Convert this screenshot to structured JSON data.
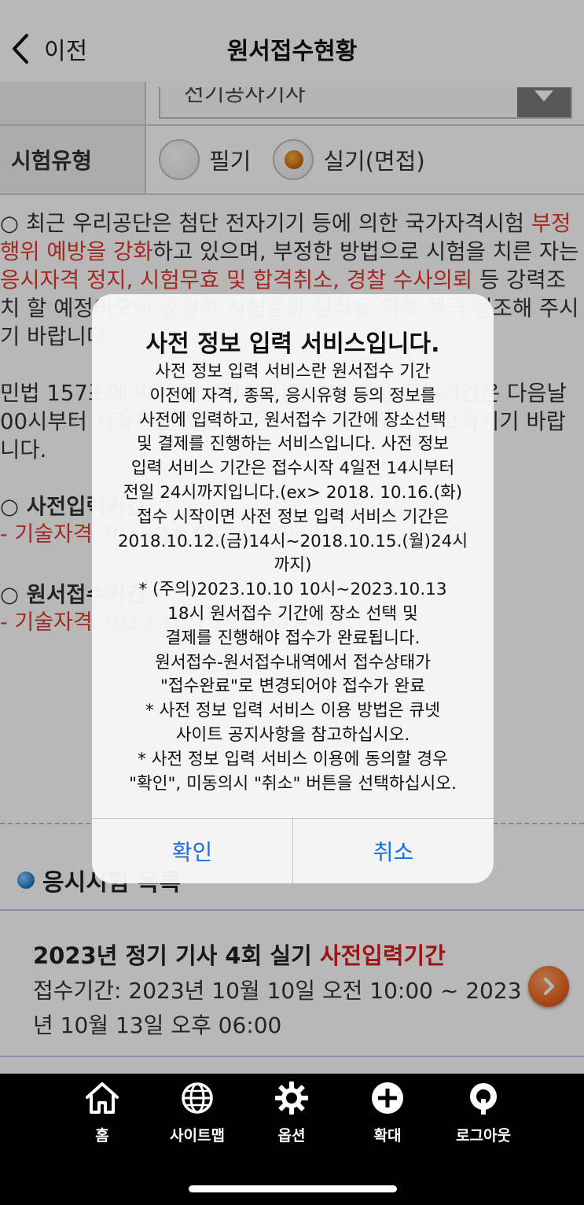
{
  "header": {
    "back_label": "이전",
    "title": "원서접수현황"
  },
  "form": {
    "category_value": "전기공사기사",
    "exam_type_label": "시험유형",
    "options": [
      "필기",
      "실기(면접)"
    ],
    "selected_option": "실기(면접)"
  },
  "notice": {
    "p1_a": "○ 최근 우리공단은 첨단 전자기기 등에 의한 국가자격시험 ",
    "p1_red1": "부정행위 예방을 강화",
    "p1_b": "하고 있으며, 부정한 방법으로 시험을 치른 자는 ",
    "p1_red2": "응시자격 정지, 시험무효 및 합격취소, 경찰 수사의뢰",
    "p1_c": " 등 강력조치 할 예정이오니 공정한 시험문화 정착을 위해 적극 협조해 주시기 바랍니다.",
    "p2": "민법 157조에 따라 원서접수 시작일에 대한 면제기간은 다음날 00시부터 시작하는 것을 기준으로 적용되오니 참고하시기 바랍니다.",
    "s1_head": "○ 사전입력기간",
    "s1_line": "- 기술자격  2023.10.06 14:00부터",
    "s2_head": "○ 원서접수기간",
    "s2_line": "- 기술자격  2023.10.10 10:00 부터"
  },
  "schedule": {
    "heading": "응시시험 목록",
    "card_title": "2023년 정기 기사 4회 실기 ",
    "card_badge": "사전입력기간",
    "card_period": "접수기간: 2023년 10월 10일 오전 10:00 ~ 2023년 10월 13일 오후 06:00"
  },
  "dialog": {
    "title": "사전 정보 입력 서비스입니다.",
    "lines": [
      "사전 정보 입력 서비스란 원서접수 기간",
      "이전에 자격, 종목, 응시유형 등의 정보를",
      "사전에 입력하고, 원서접수 기간에 장소선택",
      "및 결제를 진행하는 서비스입니다. 사전 정보",
      "입력 서비스 기간은 접수시작 4일전 14시부터",
      "전일 24시까지입니다.(ex> 2018. 10.16.(화)",
      "접수 시작이면 사전 정보 입력 서비스 기간은",
      "2018.10.12.(금)14시~2018.10.15.(월)24시",
      "까지)",
      "* (주의)2023.10.10 10시~2023.10.13",
      "18시 원서접수 기간에 장소 선택 및",
      "결제를 진행해야 접수가 완료됩니다.",
      "원서접수-원서접수내역에서 접수상태가",
      "\"접수완료\"로 변경되어야 접수가 완료",
      "* 사전 정보 입력 서비스 이용 방법은 큐넷",
      "사이트 공지사항을 참고하십시오.",
      "* 사전 정보 입력 서비스 이용에 동의할 경우",
      "\"확인\", 미동의시 \"취소\" 버튼을 선택하십시오."
    ],
    "confirm_label": "확인",
    "cancel_label": "취소"
  },
  "tabbar": {
    "items": [
      {
        "label": "홈",
        "icon": "home-icon"
      },
      {
        "label": "사이트맵",
        "icon": "globe-icon"
      },
      {
        "label": "옵션",
        "icon": "gear-icon"
      },
      {
        "label": "확대",
        "icon": "zoom-plus-icon"
      },
      {
        "label": "로그아웃",
        "icon": "power-icon"
      }
    ]
  },
  "colors": {
    "accent_red": "#e03a2e",
    "dialog_button_blue": "#1a6fe0",
    "radio_selected": "#d06f0c"
  }
}
